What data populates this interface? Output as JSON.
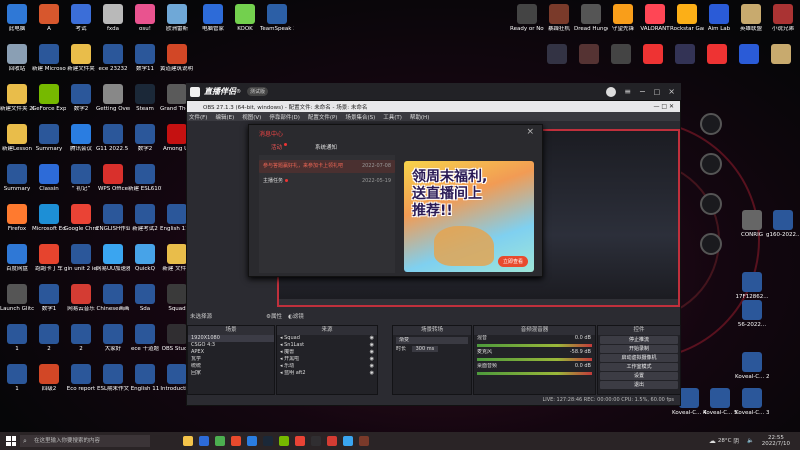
{
  "desktop_left": [
    {
      "label": "此电脑",
      "color": "#2f78d6"
    },
    {
      "label": "A",
      "color": "#d7572d"
    },
    {
      "label": "考试",
      "color": "#3b6ed8"
    },
    {
      "label": "fxda",
      "color": "#b9b9b9"
    },
    {
      "label": "osu!",
      "color": "#e9538f"
    },
    {
      "label": "欧洲雷斯",
      "color": "#6fa8d7"
    },
    {
      "label": "电脑管家",
      "color": "#2d6bd8"
    },
    {
      "label": "KOOK",
      "color": "#73d04e"
    },
    {
      "label": "TeamSpeak 3",
      "color": "#2c5fa6"
    },
    {
      "label": "回收站",
      "color": "#8a9fb4"
    },
    {
      "label": "新建 Microsoft...",
      "color": "#2b579a"
    },
    {
      "label": "新建文件夹",
      "color": "#e9bd4a"
    },
    {
      "label": "ece 23232",
      "color": "#2b579a"
    },
    {
      "label": "数学11",
      "color": "#2b579a"
    },
    {
      "label": "黄道建筑说明 ppt",
      "color": "#d24726"
    },
    {
      "label": "新建文件夹 2022022...",
      "color": "#e9bd4a"
    },
    {
      "label": "GeForce Experience",
      "color": "#76b900"
    },
    {
      "label": "数学2",
      "color": "#2b579a"
    },
    {
      "label": "Getting Over It wi...",
      "color": "#888"
    },
    {
      "label": "Steam",
      "color": "#1b2838"
    },
    {
      "label": "Grand Theft Auto",
      "color": "#5a5a5a"
    },
    {
      "label": "新建Lesson",
      "color": "#e9bd4a"
    },
    {
      "label": "Summary",
      "color": "#2b579a"
    },
    {
      "label": "腾讯会议",
      "color": "#2a7de1"
    },
    {
      "label": "G11 2022.5 weekly test",
      "color": "#2b579a"
    },
    {
      "label": "数学2",
      "color": "#2b579a"
    },
    {
      "label": "Among Us",
      "color": "#c51111"
    },
    {
      "label": "ESL6236...",
      "color": "#2b579a"
    },
    {
      "label": "Summary",
      "color": "#2b579a"
    },
    {
      "label": "Classin",
      "color": "#2d6bd8"
    },
    {
      "label": "“ 初记”",
      "color": "#2b579a"
    },
    {
      "label": "WPS Office",
      "color": "#d9302c"
    },
    {
      "label": "新建 ESL6101...",
      "color": "#2b579a"
    },
    {
      "label": "Firefox",
      "color": "#ff7a2f"
    },
    {
      "label": "Microsoft Edge",
      "color": "#1d8fd6"
    },
    {
      "label": "Google Chrome",
      "color": "#ea4335"
    },
    {
      "label": "ENGLISH作业",
      "color": "#2b579a"
    },
    {
      "label": "新建考试2",
      "color": "#2b579a"
    },
    {
      "label": "English 11 Work 10/09",
      "color": "#2b579a"
    },
    {
      "label": "百度网盘",
      "color": "#2f78d6"
    },
    {
      "label": "跑跑卡丁车",
      "color": "#e6442e"
    },
    {
      "label": "gin unit 2 ie3 exam...",
      "color": "#2b579a"
    },
    {
      "label": "网易UU加速器",
      "color": "#3aa5f0"
    },
    {
      "label": "QuickQ",
      "color": "#47a3e8"
    },
    {
      "label": "新建 文件夹",
      "color": "#e9bd4a"
    },
    {
      "label": "Launch Glitch",
      "color": "#555"
    },
    {
      "label": "数学1",
      "color": "#2b579a"
    },
    {
      "label": "网易云音乐",
      "color": "#d43c33"
    },
    {
      "label": "Chinese画画",
      "color": "#2b579a"
    },
    {
      "label": "Sda",
      "color": "#2b579a"
    },
    {
      "label": "Squad",
      "color": "#3a3a3a"
    },
    {
      "label": "数学",
      "color": "#2b579a"
    },
    {
      "label": "1",
      "color": "#2b579a"
    },
    {
      "label": "2",
      "color": "#2b579a"
    },
    {
      "label": "2",
      "color": "#2b579a"
    },
    {
      "label": "大家好",
      "color": "#2b579a"
    },
    {
      "label": "ece 十道题",
      "color": "#2b579a"
    },
    {
      "label": "OBS Studio",
      "color": "#302e31"
    },
    {
      "label": "1",
      "color": "#2b579a"
    },
    {
      "label": "四级2",
      "color": "#d24726"
    },
    {
      "label": "Eco report",
      "color": "#2b579a"
    },
    {
      "label": "ESL期末作文",
      "color": "#2b579a"
    },
    {
      "label": "English 11",
      "color": "#2b579a"
    },
    {
      "label": "Introduction",
      "color": "#2b579a"
    },
    {
      "label": "Characters in Rome...",
      "color": "#2b579a"
    },
    {
      "label": "Overcook... 2",
      "color": "#e37a2c"
    },
    {
      "label": "新建 DOCX 文档",
      "color": "#2b579a"
    }
  ],
  "desktop_right": [
    {
      "label": "Ready or Not",
      "color": "#444"
    },
    {
      "label": "暴躁狂机",
      "color": "#7a3a2a"
    },
    {
      "label": "Dread Hunger",
      "color": "#555"
    },
    {
      "label": "守望先锋",
      "color": "#f99e1a"
    },
    {
      "label": "VALORANT",
      "color": "#ff4655"
    },
    {
      "label": "Rockstar Games...",
      "color": "#fcaf17"
    },
    {
      "label": "Aim Lab",
      "color": "#2a5bd7"
    },
    {
      "label": "英雄联盟",
      "color": "#c8aa6e"
    },
    {
      "label": "小说兄弟",
      "color": "#a33"
    },
    {
      "label": "",
      "color": "#334"
    },
    {
      "label": "",
      "color": "#533"
    },
    {
      "label": "",
      "color": "#444"
    },
    {
      "label": "",
      "color": "#e33"
    },
    {
      "label": "",
      "color": "#335"
    },
    {
      "label": "",
      "color": "#e33"
    },
    {
      "label": "",
      "color": "#2a5bd7"
    },
    {
      "label": "",
      "color": "#c8aa6e"
    },
    {
      "label": "CONRIG",
      "color": "#666"
    },
    {
      "label": "g160-2022...",
      "color": "#2b579a"
    },
    {
      "label": "17F12862...",
      "color": "#2b579a"
    },
    {
      "label": "56-2022...",
      "color": "#2b579a"
    },
    {
      "label": "Koveal-C... 2",
      "color": "#2b579a"
    },
    {
      "label": "Koveal-C... 4",
      "color": "#2b579a"
    },
    {
      "label": "Koveal-C... 5",
      "color": "#2b579a"
    },
    {
      "label": "Koveal-C... 3",
      "color": "#2b579a"
    }
  ],
  "zhibo": {
    "brand": "直播伴侣",
    "brand_suffix": "®",
    "version_badge": "测试版"
  },
  "obs": {
    "title": "OBS 27.1.3 (64-bit, windows) - 配置文件: 未命名 - 场景: 未命名",
    "menu": [
      "文件(F)",
      "编辑(E)",
      "视图(V)",
      "停靠部件(D)",
      "配置文件(P)",
      "场景集合(S)",
      "工具(T)",
      "帮助(H)"
    ],
    "no_source": "未选择源",
    "props_btn": "属性",
    "filter_btn": "滤镜",
    "docks": {
      "scenes": {
        "title": "场景",
        "items": [
          "1920X1080",
          "CSGO 4:3",
          "APEX",
          "瓦学",
          "统统",
          "回家"
        ]
      },
      "sources": {
        "title": "来源",
        "items": [
          "Squad",
          "Sn1Last",
          "魔兽",
          "开黑啦",
          "乐动",
          "蓝明 aft2"
        ]
      },
      "mixer": {
        "title": "音频混音器",
        "items": [
          {
            "name": "混音",
            "db": "0.0 dB"
          },
          {
            "name": "麦克风",
            "db": "-58.9 dB"
          },
          {
            "name": "桌面音频",
            "db": "0.0 dB"
          }
        ]
      },
      "transitions": {
        "title": "场景转场",
        "mode": "渐变",
        "duration_label": "时长",
        "duration": "300 ms"
      },
      "controls": {
        "title": "控件",
        "buttons": [
          "停止推流",
          "开始录制",
          "启动虚拟摄像机",
          "工作室模式",
          "设置",
          "退出"
        ]
      }
    },
    "status": "LIVE: 127:28:46  REC: 00:00:00  CPU: 1.5%, 60.00 fps"
  },
  "dialog": {
    "title": "消息中心",
    "tabs": [
      "活动",
      "系统通知"
    ],
    "items": [
      {
        "text": "参与答题赢好礼，来参加卡上领礼吧",
        "date": "2022-07-08",
        "highlight": true
      },
      {
        "text": "主播任务",
        "date": "2022-05-19",
        "highlight": false
      }
    ],
    "banner_lines": [
      "领周末福利,",
      "送直播间上",
      "推荐!!"
    ],
    "banner_button": "立即查看",
    "close": "×"
  },
  "taskbar": {
    "search_placeholder": "在这里输入你要搜索的内容",
    "temperature": "28°C",
    "weather": "阴",
    "time": "22:55",
    "date": "2022/7/10"
  }
}
